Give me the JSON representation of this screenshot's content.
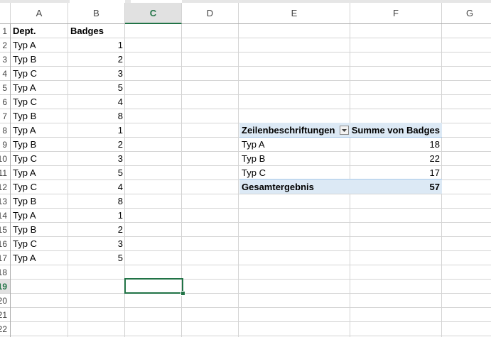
{
  "columns": [
    "A",
    "B",
    "C",
    "D",
    "E",
    "F",
    "G"
  ],
  "selected_column": "C",
  "rows": [
    "1",
    "2",
    "3",
    "4",
    "5",
    "6",
    "7",
    "8",
    "9",
    "10",
    "11",
    "12",
    "13",
    "14",
    "15",
    "16",
    "17",
    "18",
    "19",
    "20",
    "21",
    "22"
  ],
  "selected_row": "19",
  "source_table": {
    "header_dept": "Dept.",
    "header_badges": "Badges",
    "records": [
      {
        "dept": "Typ A",
        "badges": "1"
      },
      {
        "dept": "Typ B",
        "badges": "2"
      },
      {
        "dept": "Typ C",
        "badges": "3"
      },
      {
        "dept": "Typ A",
        "badges": "5"
      },
      {
        "dept": "Typ C",
        "badges": "4"
      },
      {
        "dept": "Typ B",
        "badges": "8"
      },
      {
        "dept": "Typ A",
        "badges": "1"
      },
      {
        "dept": "Typ B",
        "badges": "2"
      },
      {
        "dept": "Typ C",
        "badges": "3"
      },
      {
        "dept": "Typ A",
        "badges": "5"
      },
      {
        "dept": "Typ C",
        "badges": "4"
      },
      {
        "dept": "Typ B",
        "badges": "8"
      },
      {
        "dept": "Typ A",
        "badges": "1"
      },
      {
        "dept": "Typ B",
        "badges": "2"
      },
      {
        "dept": "Typ C",
        "badges": "3"
      },
      {
        "dept": "Typ A",
        "badges": "5"
      }
    ]
  },
  "pivot": {
    "row_labels_header": "Zeilenbeschriftungen",
    "value_header": "Summe von Badges",
    "rows": [
      {
        "label": "Typ A",
        "value": "18"
      },
      {
        "label": "Typ B",
        "value": "22"
      },
      {
        "label": "Typ C",
        "value": "17"
      }
    ],
    "total_label": "Gesamtergebnis",
    "total_value": "57",
    "filter_icon": "dropdown-arrow-icon"
  },
  "colors": {
    "accent": "#217346",
    "pivot_band": "#dce9f5",
    "grid": "#d4d4d4"
  }
}
